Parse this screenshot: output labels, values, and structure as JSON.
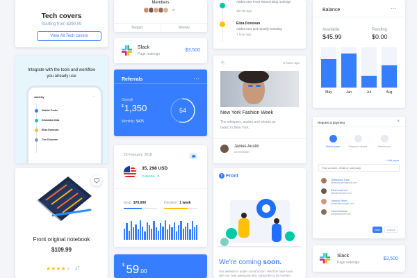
{
  "colors": {
    "primary": "#377dff",
    "success": "#00c9a7",
    "warning": "#ffc107",
    "dark": "#1e2022",
    "muted": "#8c98a4",
    "light_bg": "#e7f6fd"
  },
  "tech_covers": {
    "title": "Tech covers",
    "subtitle": "Starting from $399.99",
    "button": "View All Tech covers"
  },
  "integrate": {
    "headline": "Integrate with the tools and workflow you already use",
    "mock_title": "Activity",
    "mock_items": [
      "Natalie Curtis",
      "Sebastian Diaz",
      "Eliza Donovan",
      "Cris Donovan"
    ]
  },
  "notebook": {
    "name": "Front original notebook",
    "price": "$109.99",
    "rating": 4,
    "reviews": "17",
    "heart_icon": "heart-icon"
  },
  "members": {
    "label": "Members",
    "extra_count": "+3",
    "tabs": [
      "Budget",
      "Weekly"
    ]
  },
  "slack_mid": {
    "name": "Slack",
    "subtitle": "Page redesign",
    "price": "$3,500"
  },
  "referrals": {
    "title": "Referrals",
    "overall_label": "Overall",
    "overall_currency": "$",
    "overall_value": "1,350",
    "monthly_label": "Monthly:",
    "monthly_value": "$425",
    "ring_value": "54",
    "ring_progress": 0.54
  },
  "crypto": {
    "date": "20 February, 2018",
    "amount": "35, 298 USD",
    "currency": "CANADA",
    "goal_label": "Goal:",
    "goal_value": "$70,000",
    "duration_label": "Duration:",
    "duration_value": "1 week",
    "goal_progress": 0.55,
    "duration_progress": 0.7,
    "bars": [
      0.55,
      0.8,
      0.45,
      0.9,
      0.6,
      0.75,
      0.5,
      0.95,
      0.65,
      0.4,
      0.85,
      0.7,
      0.55,
      0.9,
      0.6,
      0.45,
      0.8,
      0.65,
      0.95,
      0.5,
      0.75,
      0.6,
      0.85,
      0.4,
      0.7,
      0.9,
      0.55,
      0.65,
      0.8,
      0.5,
      0.9,
      0.6,
      0.7
    ]
  },
  "price_card": {
    "currency": "$",
    "value": "59",
    "cents": ".00"
  },
  "activity_feed": {
    "items": [
      {
        "text": "Added new Front Repost Blog redesign",
        "time": "48 min ago",
        "dot": "#00c9a7"
      },
      {
        "name": "Eliza Donovan",
        "text": "Added new task Spotify branding",
        "time": "1 hour ago",
        "dot": "#ffc107"
      }
    ]
  },
  "fashion": {
    "time": "3 hours ago",
    "title": "New York Fashion Week",
    "body": "The whispers, asides and shouts as heard in New York.",
    "author": "James Austin",
    "author_sub": "on Invision"
  },
  "coming_soon": {
    "brand": "Front",
    "headline_a": "We're coming ",
    "headline_b": "soon.",
    "body": "Our website is under construction. We'll be here soon with our new awesome site, subscribe to be notified."
  },
  "balance": {
    "title": "Balance",
    "available_label": "Available:",
    "available_value": "$45.99",
    "pending_label": "Pending:",
    "pending_value": "$0.00",
    "chart_data": {
      "type": "bar",
      "categories": [
        "May",
        "Jun",
        "Jul",
        "Aug"
      ],
      "series": [
        {
          "values": [
            0.7,
            0.85,
            0.3,
            0.55
          ]
        },
        {
          "values": [
            0.2,
            0.15,
            0.1,
            0.1
          ]
        }
      ]
    }
  },
  "payment": {
    "title": "Request a payment",
    "steps": [
      "Select payer",
      "Payment details",
      "Attachment"
    ],
    "search_placeholder": "Find a name, email or company",
    "add_payer": "+ Add payer",
    "people": [
      {
        "name": "Sebastian Diaz",
        "email": "sebastian@example.com"
      },
      {
        "name": "Eliot Lockhart",
        "email": "eliot@example.com"
      },
      {
        "name": "Joseph Ward",
        "email": "joseph@example.com"
      },
      {
        "name": "Cris Donovan",
        "email": "cris@example.com"
      }
    ],
    "next_button": "Next",
    "cancel_button": "Cancel"
  },
  "slack_right": {
    "name": "Slack",
    "subtitle": "Page redesign",
    "price": "$3,500"
  }
}
